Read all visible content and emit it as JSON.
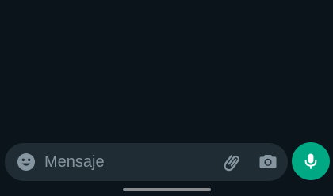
{
  "composer": {
    "placeholder": "Mensaje",
    "value": ""
  },
  "icons": {
    "emoji": "emoji-icon",
    "attach": "paperclip-icon",
    "camera": "camera-icon",
    "mic": "microphone-icon"
  },
  "colors": {
    "background": "#0b141a",
    "composer_bg": "#1f2c34",
    "icon_gray": "#8696a0",
    "accent": "#00a884",
    "home_indicator": "#8a8d8f"
  }
}
